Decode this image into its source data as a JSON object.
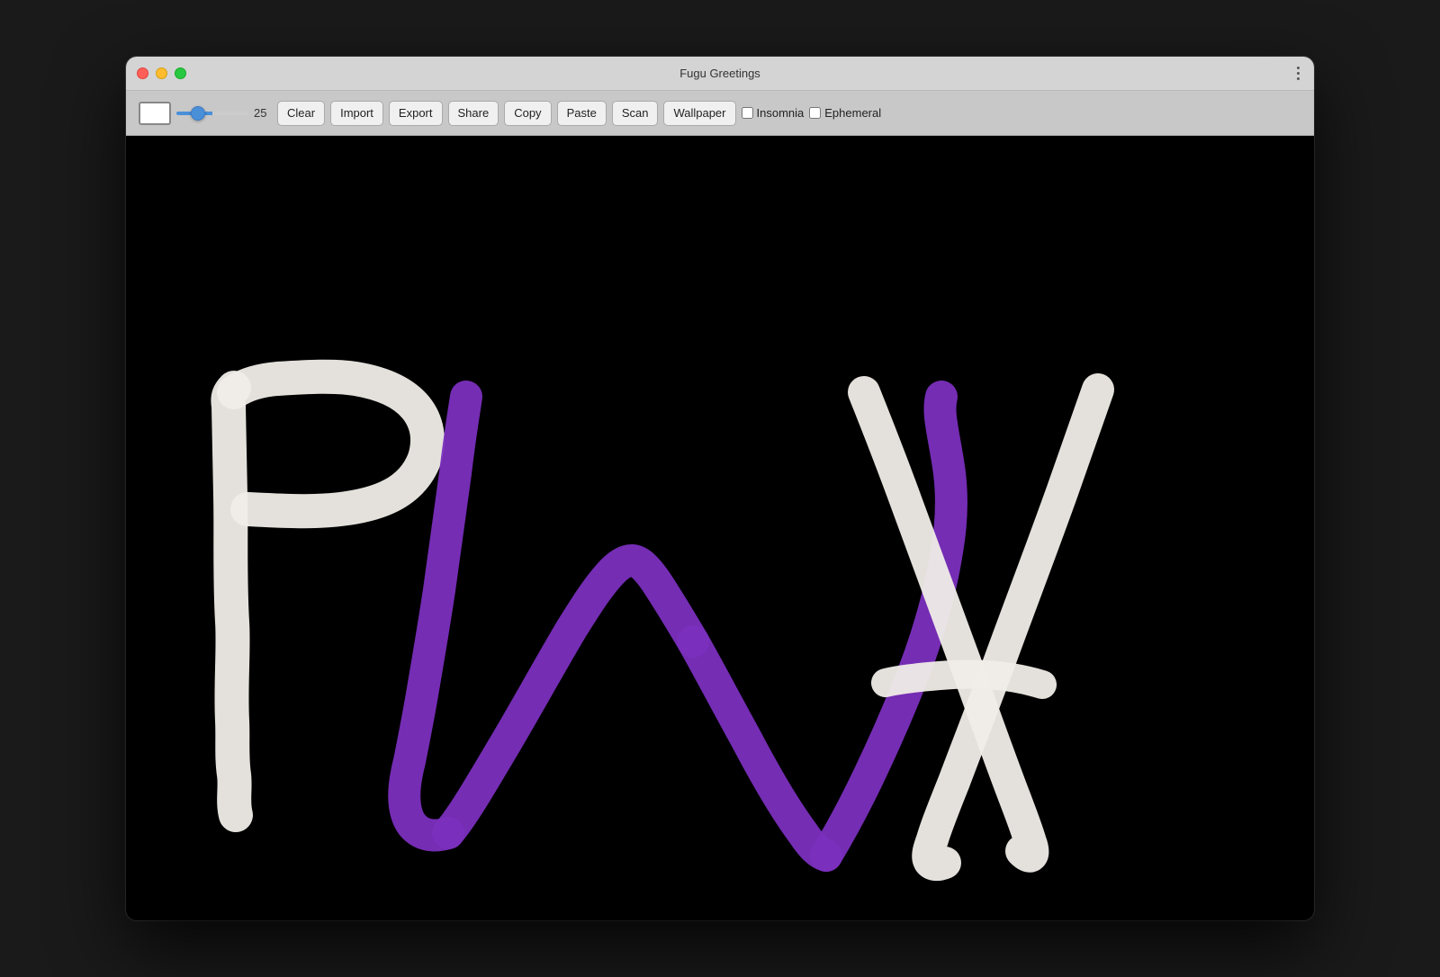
{
  "window": {
    "title": "Fugu Greetings"
  },
  "toolbar": {
    "slider_value": "25",
    "clear_label": "Clear",
    "import_label": "Import",
    "export_label": "Export",
    "share_label": "Share",
    "copy_label": "Copy",
    "paste_label": "Paste",
    "scan_label": "Scan",
    "wallpaper_label": "Wallpaper",
    "insomnia_label": "Insomnia",
    "ephemeral_label": "Ephemeral",
    "insomnia_checked": false,
    "ephemeral_checked": false
  },
  "icons": {
    "more_vert": "⋮",
    "close": "●",
    "minimize": "●",
    "maximize": "●"
  }
}
